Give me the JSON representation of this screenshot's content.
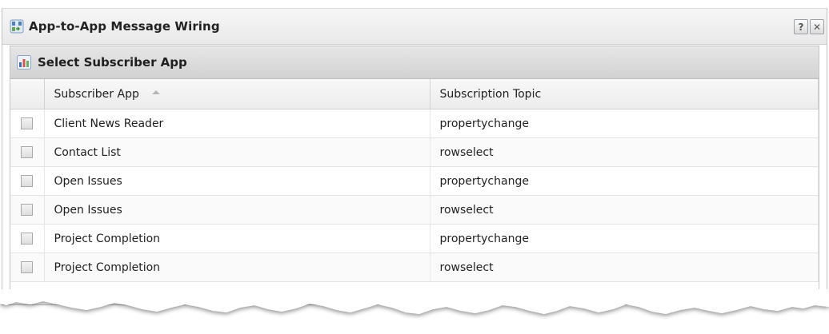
{
  "window": {
    "title": "App-to-App Message Wiring",
    "help_label": "?",
    "close_label": "✕"
  },
  "panel": {
    "title": "Select Subscriber App"
  },
  "grid": {
    "columns": [
      {
        "label": "Subscriber App",
        "sorted": "ascending"
      },
      {
        "label": "Subscription Topic"
      }
    ],
    "rows": [
      {
        "app": "Client News Reader",
        "topic": "propertychange",
        "checked": false
      },
      {
        "app": "Contact List",
        "topic": "rowselect",
        "checked": false
      },
      {
        "app": "Open Issues",
        "topic": "propertychange",
        "checked": false
      },
      {
        "app": "Open Issues",
        "topic": "rowselect",
        "checked": false
      },
      {
        "app": "Project Completion",
        "topic": "propertychange",
        "checked": false
      },
      {
        "app": "Project Completion",
        "topic": "rowselect",
        "checked": false
      }
    ]
  },
  "icons": {
    "window_icon": "wiring-app-icon",
    "panel_icon": "chart-app-icon",
    "help": "help-icon",
    "close": "close-icon",
    "sort": "sort-ascending-icon"
  }
}
